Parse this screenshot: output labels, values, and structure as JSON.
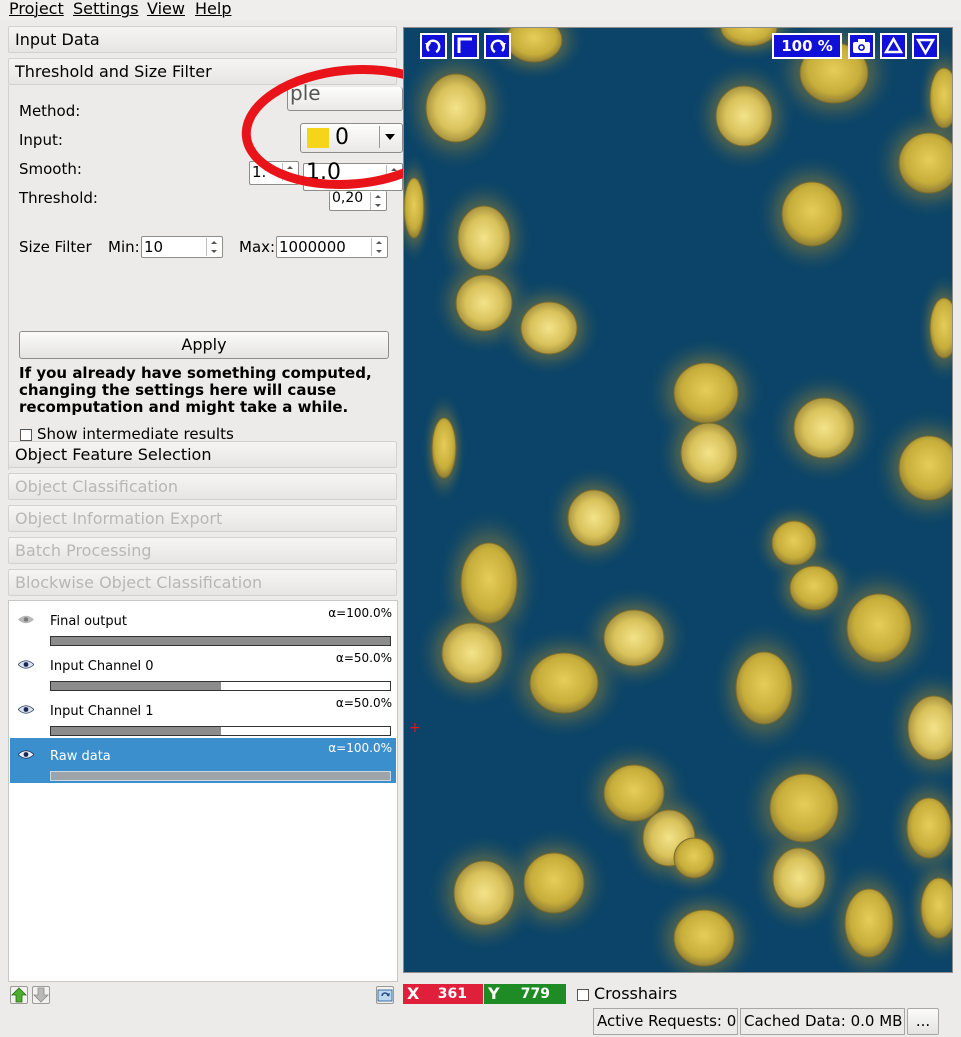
{
  "menu": [
    "Project",
    "Settings",
    "View",
    "Help"
  ],
  "applets": {
    "input_data": "Input Data",
    "threshold_filter": "Threshold and Size Filter",
    "object_feature": "Object Feature Selection",
    "disabled": [
      "Object Classification",
      "Object Information Export",
      "Batch Processing",
      "Blockwise Object Classification"
    ]
  },
  "threshold": {
    "method_label": "Method:",
    "method_value": "ple",
    "input_label": "Input:",
    "input_value": "0",
    "input_swatch": "#f5d41a",
    "smooth_label": "Smooth:",
    "smooth_value_a": "1.",
    "smooth_value_b": "1.0",
    "threshold_label": "Threshold:",
    "threshold_value": "0,20",
    "size_filter_label": "Size Filter",
    "min_label": "Min:",
    "min_value": "10",
    "max_label": "Max:",
    "max_value": "1000000",
    "apply_label": "Apply",
    "warning": "If you already have something computed, changing the settings here will cause recomputation and might take a while.",
    "show_intermediate": "Show intermediate results"
  },
  "layers": [
    {
      "name": "Final output",
      "alpha": "α=100.0%",
      "opacity": 1.0,
      "visible": false,
      "selected": false
    },
    {
      "name": "Input Channel 0",
      "alpha": "α=50.0%",
      "opacity": 0.5,
      "visible": true,
      "selected": false
    },
    {
      "name": "Input Channel 1",
      "alpha": "α=50.0%",
      "opacity": 0.5,
      "visible": true,
      "selected": false
    },
    {
      "name": "Raw data",
      "alpha": "α=100.0%",
      "opacity": 1.0,
      "visible": true,
      "selected": true
    }
  ],
  "viewer": {
    "zoom": "100 %",
    "icons": [
      "rotate-left-icon",
      "reset-view-icon",
      "rotate-right-icon",
      "camera-icon",
      "arrow-up-icon",
      "arrow-down-icon"
    ]
  },
  "status": {
    "x_label": "X",
    "x_value": "361",
    "y_label": "Y",
    "y_value": "779",
    "crosshairs": "Crosshairs",
    "active_requests": "Active Requests: 0",
    "cached_data": "Cached Data: 0.0 MB",
    "more": "..."
  },
  "colors": {
    "x_bg": "#e0203a",
    "y_bg": "#1e8b24",
    "cell": "#c9b23c",
    "cell_halo": "#6d7a50",
    "background": "#0b4468",
    "annotation": "#e8141a"
  }
}
